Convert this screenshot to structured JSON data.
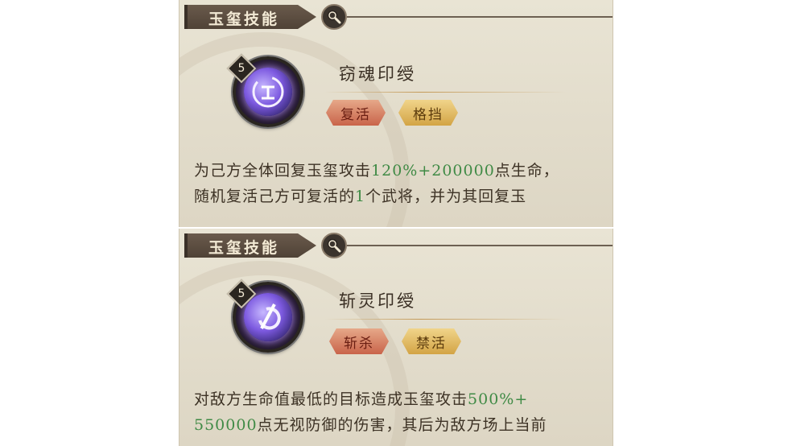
{
  "panels": [
    {
      "header": {
        "title": "玉玺技能",
        "search_icon": "magnifier-icon"
      },
      "skill": {
        "level": "5",
        "name": "窃魂印绶",
        "tags": [
          "复活",
          "格挡"
        ],
        "description": {
          "line1_a": "为己方全体回复玉玺攻击",
          "line1_hl": "120%+200000",
          "line1_b": "点生命，",
          "line2_a": "随机复活己方可复活的",
          "line2_hl": "1",
          "line2_b": "个武将，并为其回复玉"
        }
      }
    },
    {
      "header": {
        "title": "玉玺技能",
        "search_icon": "magnifier-icon"
      },
      "skill": {
        "level": "5",
        "name": "斩灵印绶",
        "tags": [
          "斩杀",
          "禁活"
        ],
        "description": {
          "line1_a": "对敌方生命值最低的目标造成玉玺攻击",
          "line1_hl": "500%+",
          "line2_hl": "550000",
          "line2_b": "点无视防御的伤害，其后为敌方场上当前"
        }
      }
    }
  ],
  "colors": {
    "highlight": "#3f8a45",
    "tag_red": "#c9644a",
    "tag_gold": "#d3a445",
    "header_bg": "#4f4236"
  }
}
